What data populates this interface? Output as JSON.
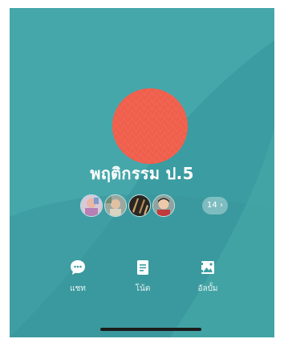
{
  "group": {
    "name": "พฤติกรรม ป.5"
  },
  "members": {
    "more_count": "14 ›"
  },
  "actions": [
    {
      "label": "แชท",
      "icon": "chat-bubble-icon"
    },
    {
      "label": "โน้ต",
      "icon": "note-icon"
    },
    {
      "label": "อัลบั้ม",
      "icon": "album-icon"
    }
  ],
  "colors": {
    "background": "#3d9ea3",
    "group_photo": "#ef5f4c",
    "text": "#ffffff"
  }
}
